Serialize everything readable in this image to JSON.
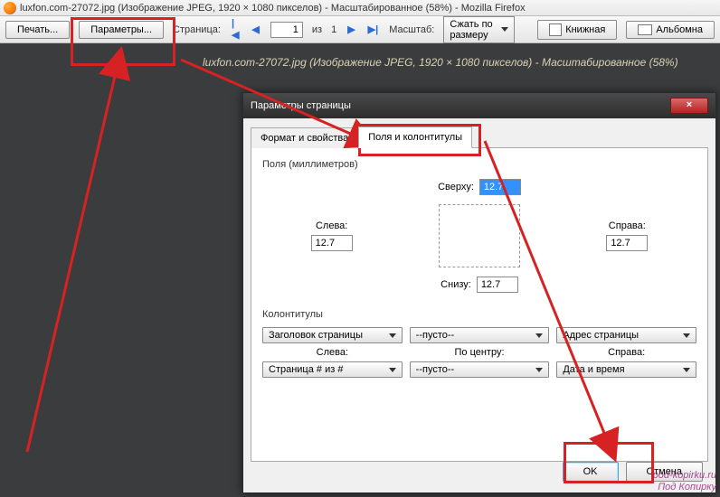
{
  "titlebar": {
    "title": "luxfon.com-27072.jpg (Изображение JPEG, 1920 × 1080 пикселов) - Масштабированное (58%) - Mozilla Firefox"
  },
  "toolbar": {
    "print": "Печать...",
    "params": "Параметры...",
    "page_label": "Страница:",
    "page_current": "1",
    "of_label": "из",
    "page_total": "1",
    "scale_label": "Масштаб:",
    "scale_value": "Сжать по размеру",
    "orient_portrait": "Книжная",
    "orient_landscape": "Альбомна"
  },
  "subheader": "luxfon.com-27072.jpg (Изображение JPEG, 1920 × 1080 пикселов) - Масштабированное (58%)",
  "dialog": {
    "title": "Параметры страницы",
    "close": "×",
    "tabs": {
      "format": "Формат и свойства",
      "margins": "Поля и колонтитулы"
    },
    "margins_group": "Поля (миллиметров)",
    "top_label": "Сверху:",
    "left_label": "Слева:",
    "right_label": "Справа:",
    "bottom_label": "Снизу:",
    "top_value": "12.7",
    "left_value": "12.7",
    "right_value": "12.7",
    "bottom_value": "12.7",
    "hf_group": "Колонтитулы",
    "hf_left_label": "Слева:",
    "hf_center_label": "По центру:",
    "hf_right_label": "Справа:",
    "hf_header": {
      "left": "Заголовок страницы",
      "center": "--пусто--",
      "right": "Адрес страницы"
    },
    "hf_footer": {
      "left": "Страница # из #",
      "center": "--пусто--",
      "right": "Дата и время"
    },
    "ok": "OK",
    "cancel": "Отмена"
  },
  "watermark": {
    "line1": "pod-kopirku.ru",
    "line2": "Под Копирку"
  }
}
